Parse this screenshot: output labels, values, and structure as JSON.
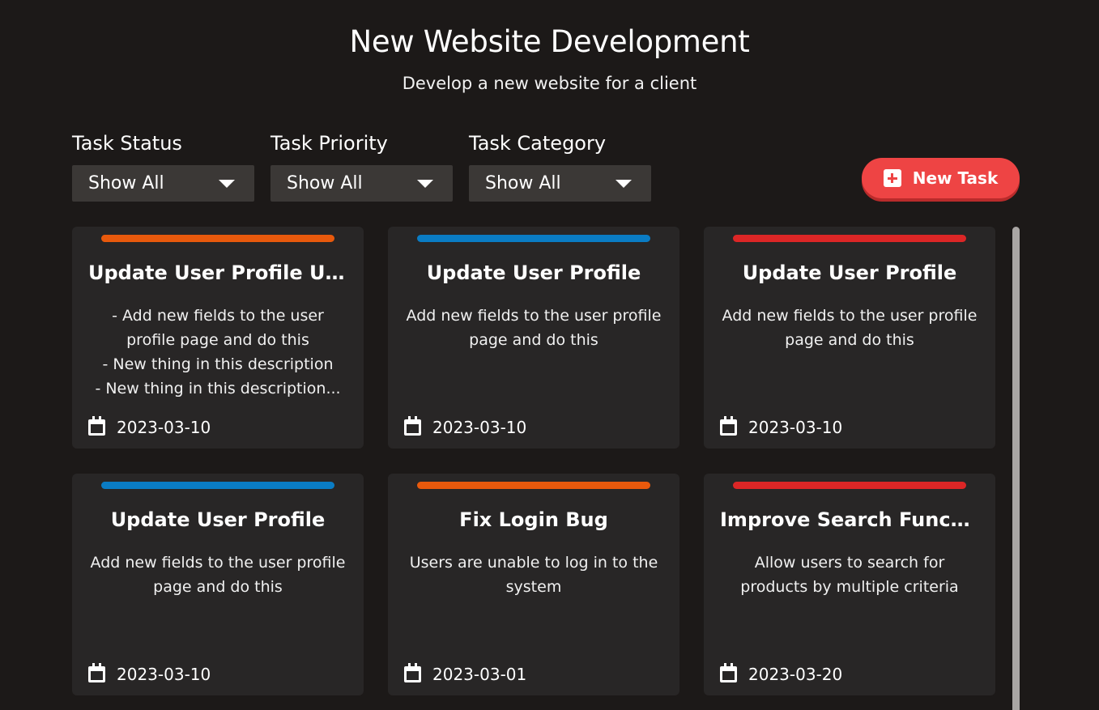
{
  "header": {
    "title": "New Website Development",
    "subtitle": "Develop a new website for a client"
  },
  "filters": [
    {
      "label": "Task Status",
      "value": "Show All"
    },
    {
      "label": "Task Priority",
      "value": "Show All"
    },
    {
      "label": "Task Category",
      "value": "Show All"
    }
  ],
  "new_task_button": {
    "label": "New Task",
    "icon": "plus-square-icon"
  },
  "colors": {
    "background": "#1c1918",
    "card": "#282626",
    "select": "#3b3836",
    "accent": "#ee4444",
    "priority_orange": "#e8590c",
    "priority_blue": "#0a7cc4",
    "priority_red": "#dc2626"
  },
  "cards": [
    {
      "title": "Update User Profile Upd...",
      "priority_color": "#e8590c",
      "description": [
        "- Add new fields to the user",
        "profile page and do this",
        "- New thing in this description",
        "- New thing in this description..."
      ],
      "date": "2023-03-10"
    },
    {
      "title": "Update User Profile",
      "priority_color": "#0a7cc4",
      "description": [
        "Add new fields to the user profile",
        "page and do this"
      ],
      "date": "2023-03-10"
    },
    {
      "title": "Update User Profile",
      "priority_color": "#dc2626",
      "description": [
        "Add new fields to the user profile",
        "page and do this"
      ],
      "date": "2023-03-10"
    },
    {
      "title": "Update User Profile",
      "priority_color": "#0a7cc4",
      "description": [
        "Add new fields to the user profile",
        "page and do this"
      ],
      "date": "2023-03-10"
    },
    {
      "title": "Fix Login Bug",
      "priority_color": "#e8590c",
      "description": [
        "Users are unable to log in to the",
        "system"
      ],
      "date": "2023-03-01"
    },
    {
      "title": "Improve Search Function...",
      "priority_color": "#dc2626",
      "description": [
        "Allow users to search for",
        "products by multiple criteria"
      ],
      "date": "2023-03-20"
    }
  ]
}
